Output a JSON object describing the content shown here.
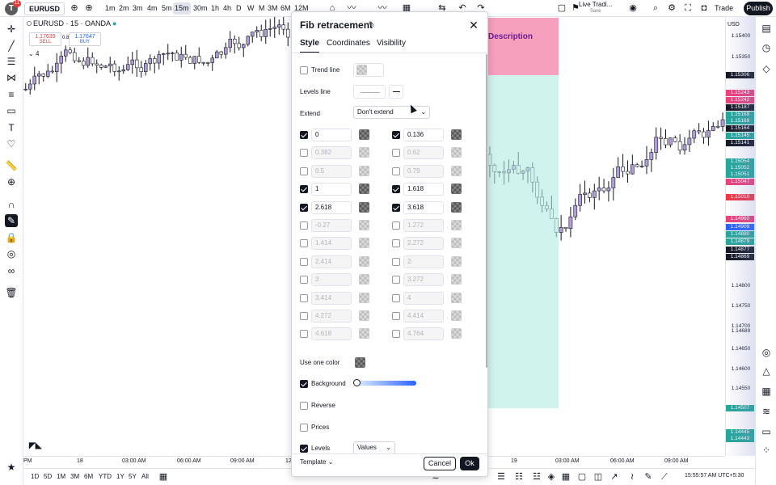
{
  "topbar": {
    "avatar_letter": "T",
    "notif_count": "11",
    "symbol": "EURUSD",
    "timeframes": [
      "1m",
      "2m",
      "3m",
      "4m",
      "5m",
      "15m",
      "30m",
      "1h",
      "4h",
      "D",
      "W",
      "M",
      "3M",
      "6M",
      "12M"
    ],
    "active_timeframe": "15m",
    "live": "Live Tradi...",
    "live_sub": "Save",
    "trade": "Trade",
    "publish": "Publish"
  },
  "legend": {
    "symbol": "EURUSD · 15 · OANDA",
    "sell_price": "1.17639",
    "sell_label": "SELL",
    "buy_price": "1.17647",
    "buy_label": "BUY",
    "spread": "0.8",
    "collapse": "4"
  },
  "fib_description": "Description",
  "price_scale": {
    "currency": "USD",
    "labels": [
      {
        "v": "1.15400",
        "kind": "plain"
      },
      {
        "v": "1.15350",
        "kind": "plain"
      },
      {
        "v": "1.15306",
        "kind": "black"
      },
      {
        "v": "1.15243",
        "kind": "pink"
      },
      {
        "v": "1.15242",
        "kind": "pink"
      },
      {
        "v": "1.15187",
        "kind": "black"
      },
      {
        "v": "1.15169",
        "kind": "teal"
      },
      {
        "v": "1.15169",
        "kind": "teal"
      },
      {
        "v": "1.15164",
        "kind": "black"
      },
      {
        "v": "1.15145",
        "kind": "teal"
      },
      {
        "v": "1.15141",
        "kind": "black"
      },
      {
        "v": "1.15054",
        "kind": "teal"
      },
      {
        "v": "1.15052",
        "kind": "teal"
      },
      {
        "v": "1.15051",
        "kind": "teal"
      },
      {
        "v": "1.15047",
        "kind": "pink"
      },
      {
        "v": "1.15010",
        "kind": "red"
      },
      {
        "v": "1.14960",
        "kind": "pink"
      },
      {
        "v": "1.14909",
        "kind": "blue"
      },
      {
        "v": "1.14880",
        "kind": "teal"
      },
      {
        "v": "1.14879",
        "kind": "teal"
      },
      {
        "v": "1.14877",
        "kind": "black"
      },
      {
        "v": "1.14869",
        "kind": "black"
      },
      {
        "v": "1.14800",
        "kind": "plain"
      },
      {
        "v": "1.14750",
        "kind": "plain"
      },
      {
        "v": "1.14700",
        "kind": "plain"
      },
      {
        "v": "1.14689",
        "kind": "plain"
      },
      {
        "v": "1.14650",
        "kind": "plain"
      },
      {
        "v": "1.14600",
        "kind": "plain"
      },
      {
        "v": "1.14550",
        "kind": "plain"
      },
      {
        "v": "1.14507",
        "kind": "teal"
      },
      {
        "v": "1.14445",
        "kind": "teal"
      },
      {
        "v": "1.14443",
        "kind": "teal"
      }
    ]
  },
  "time_axis": {
    "left": [
      {
        "t": "PM"
      },
      {
        "t": "18"
      },
      {
        "t": "03:00 AM"
      },
      {
        "t": "06:00 AM"
      },
      {
        "t": "09:00 AM"
      },
      {
        "t": "12"
      }
    ],
    "right": [
      {
        "t": "19"
      },
      {
        "t": "03:00 AM"
      },
      {
        "t": "06:00 AM"
      },
      {
        "t": "09:00 AM"
      }
    ]
  },
  "bottombar": {
    "ranges": [
      "1D",
      "5D",
      "1M",
      "3M",
      "6M",
      "YTD",
      "1Y",
      "5Y",
      "All"
    ],
    "clock": "15:55:57 AM UTC+5:30"
  },
  "dialog": {
    "title": "Fib retracement",
    "tabs": [
      "Style",
      "Coordinates",
      "Visibility"
    ],
    "trend_line": "Trend line",
    "levels_line": "Levels line",
    "extend_label": "Extend",
    "extend_value": "Don't extend",
    "levels": [
      {
        "v": "0",
        "on": true
      },
      {
        "v": "0.136",
        "on": true
      },
      {
        "v": "0.382",
        "on": false
      },
      {
        "v": "0.62",
        "on": false
      },
      {
        "v": "0.5",
        "on": false
      },
      {
        "v": "0.79",
        "on": false
      },
      {
        "v": "1",
        "on": true
      },
      {
        "v": "1.618",
        "on": true
      },
      {
        "v": "2.618",
        "on": true
      },
      {
        "v": "3.618",
        "on": true
      },
      {
        "v": "-0.27",
        "on": false
      },
      {
        "v": "1.272",
        "on": false
      },
      {
        "v": "1.414",
        "on": false
      },
      {
        "v": "2.272",
        "on": false
      },
      {
        "v": "2.414",
        "on": false
      },
      {
        "v": "2",
        "on": false
      },
      {
        "v": "3",
        "on": false
      },
      {
        "v": "3.272",
        "on": false
      },
      {
        "v": "3.414",
        "on": false
      },
      {
        "v": "4",
        "on": false
      },
      {
        "v": "4.272",
        "on": false
      },
      {
        "v": "4.414",
        "on": false
      },
      {
        "v": "4.618",
        "on": false
      },
      {
        "v": "4.764",
        "on": false
      }
    ],
    "use_one_color": "Use one color",
    "background": "Background",
    "reverse": "Reverse",
    "prices": "Prices",
    "levels_label": "Levels",
    "levels_select": "Values",
    "template": "Template",
    "cancel": "Cancel",
    "ok": "Ok"
  },
  "colors": {
    "accent": "#131722",
    "fib_pink": "#f48fb1",
    "fib_teal": "#b2ebe1",
    "candle_body": "#b39ddb",
    "candle_wick": "#131722"
  }
}
